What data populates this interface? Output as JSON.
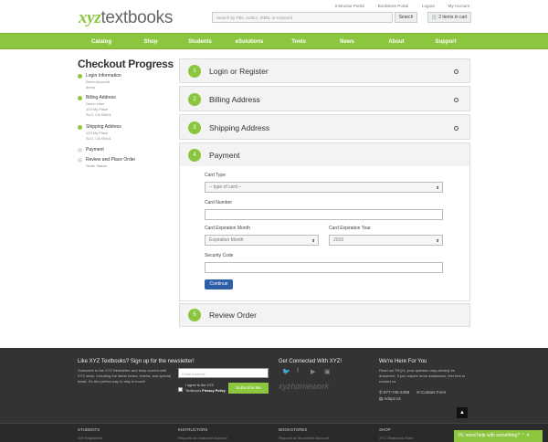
{
  "header": {
    "logo_xyz": "xyz",
    "logo_rest": "textbooks",
    "top_links": [
      "Instructor Portal",
      "Bookstore Portal",
      "Logout",
      "My Account"
    ],
    "search_placeholder": "Search by Title, Author, ISBN, or Keyword",
    "search_button": "Search",
    "cart_label": "2 items in cart"
  },
  "nav": {
    "items": [
      "Catalog",
      "Shop",
      "Students",
      "eSolutions",
      "Tools",
      "News",
      "About",
      "Support"
    ]
  },
  "sidebar": {
    "title": "Checkout Progress",
    "steps": [
      {
        "label": "Login Information",
        "sub": [
          "Demo Account",
          "demo"
        ],
        "done": true
      },
      {
        "label": "Billing Address",
        "sub": [
          "Demo User",
          "123 My Place",
          "SLO, CA 93401"
        ],
        "done": true
      },
      {
        "label": "Shipping Address",
        "sub": [
          "123 My Place",
          "SLO, CA 93401"
        ],
        "done": true
      },
      {
        "label": "Payment",
        "sub": [],
        "done": false
      },
      {
        "label": "Review and Place Order",
        "sub": [
          "Order Status:"
        ],
        "done": false
      }
    ]
  },
  "checkout": {
    "panels": [
      {
        "number": "1",
        "title": "Login or Register"
      },
      {
        "number": "2",
        "title": "Billing Address"
      },
      {
        "number": "3",
        "title": "Shipping Address"
      },
      {
        "number": "4",
        "title": "Payment"
      },
      {
        "number": "5",
        "title": "Review Order"
      }
    ],
    "payment": {
      "card_type_label": "Card Type",
      "card_type_value": "-- type of card --",
      "card_number_label": "Card Number",
      "exp_month_label": "Card Expiration Month",
      "exp_month_value": "Expiration Month",
      "exp_year_label": "Card Expiration Year",
      "exp_year_value": "2015",
      "security_label": "Security Code",
      "continue_label": "Continue"
    }
  },
  "footer": {
    "newsletter_title": "Like XYZ Textbooks? Sign up for the newsletter!",
    "newsletter_text": "Subscribe to the XYZ Newsletter and keep current with XYZ news, including the latest books, events, and special deals. It's the perfect way to stay in touch!",
    "email_placeholder": "Email Address",
    "agree_prefix": "I agree to the XYZ Textbooks",
    "agree_link": "Privacy Policy",
    "subscribe_label": "Subscribe Me",
    "connect_title": "Get Connected With XYZ!",
    "social_icons": [
      "twitter-icon",
      "facebook-icon",
      "youtube-icon",
      "vimeo-icon"
    ],
    "homework_logo": "xyzhomework",
    "help_title": "We're Here For You",
    "help_text": "Read our FAQ's, your question may already be answered. If you require more assistance, feel free to contact us.",
    "phone": "877-745-3499",
    "contact_form": "Contact Form",
    "adopt_us": "Adopt Us",
    "columns": [
      {
        "title": "STUDENTS",
        "link": "Get Registered"
      },
      {
        "title": "INSTRUCTORS",
        "link": "Request an Instructor Account"
      },
      {
        "title": "BOOKSTORES",
        "link": "Request an Bookstore Account"
      },
      {
        "title": "SHOP",
        "link": "XYZ Textbooks Store"
      }
    ],
    "chat_label": "Hi, need help with something?"
  }
}
